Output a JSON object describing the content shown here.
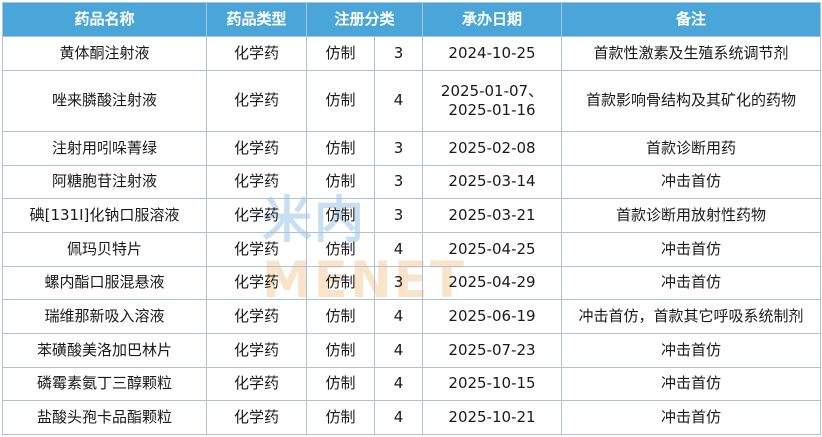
{
  "headers": [
    "药品名称",
    "药品类型",
    "注册分类",
    "承办日期",
    "备注"
  ],
  "rows": [
    {
      "name": "黄体酮注射液",
      "type": "化学药",
      "reg_kind": "仿制",
      "reg_class": "3",
      "date": "2024-10-25",
      "note": "首款性激素及生殖系统调节剂"
    },
    {
      "name": "唑来膦酸注射液",
      "type": "化学药",
      "reg_kind": "仿制",
      "reg_class": "4",
      "date": "2025-01-07、2025-01-16",
      "note": "首款影响骨结构及其矿化的药物"
    },
    {
      "name": "注射用吲哚菁绿",
      "type": "化学药",
      "reg_kind": "仿制",
      "reg_class": "3",
      "date": "2025-02-08",
      "note": "首款诊断用药"
    },
    {
      "name": "阿糖胞苷注射液",
      "type": "化学药",
      "reg_kind": "仿制",
      "reg_class": "3",
      "date": "2025-03-14",
      "note": "冲击首仿"
    },
    {
      "name": "碘[131I]化钠口服溶液",
      "type": "化学药",
      "reg_kind": "仿制",
      "reg_class": "3",
      "date": "2025-03-21",
      "note": "首款诊断用放射性药物"
    },
    {
      "name": "佩玛贝特片",
      "type": "化学药",
      "reg_kind": "仿制",
      "reg_class": "4",
      "date": "2025-04-25",
      "note": "冲击首仿"
    },
    {
      "name": "螺内酯口服混悬液",
      "type": "化学药",
      "reg_kind": "仿制",
      "reg_class": "3",
      "date": "2025-04-29",
      "note": "冲击首仿"
    },
    {
      "name": "瑞维那新吸入溶液",
      "type": "化学药",
      "reg_kind": "仿制",
      "reg_class": "4",
      "date": "2025-06-19",
      "note": "冲击首仿，首款其它呼吸系统制剂"
    },
    {
      "name": "苯磺酸美洛加巴林片",
      "type": "化学药",
      "reg_kind": "仿制",
      "reg_class": "4",
      "date": "2025-07-23",
      "note": "冲击首仿"
    },
    {
      "name": "磷霉素氨丁三醇颗粒",
      "type": "化学药",
      "reg_kind": "仿制",
      "reg_class": "4",
      "date": "2025-10-15",
      "note": "冲击首仿"
    },
    {
      "name": "盐酸头孢卡品酯颗粒",
      "type": "化学药",
      "reg_kind": "仿制",
      "reg_class": "4",
      "date": "2025-10-21",
      "note": "冲击首仿"
    }
  ],
  "watermark": {
    "part_a": "米内",
    "part_b": "MENET"
  }
}
